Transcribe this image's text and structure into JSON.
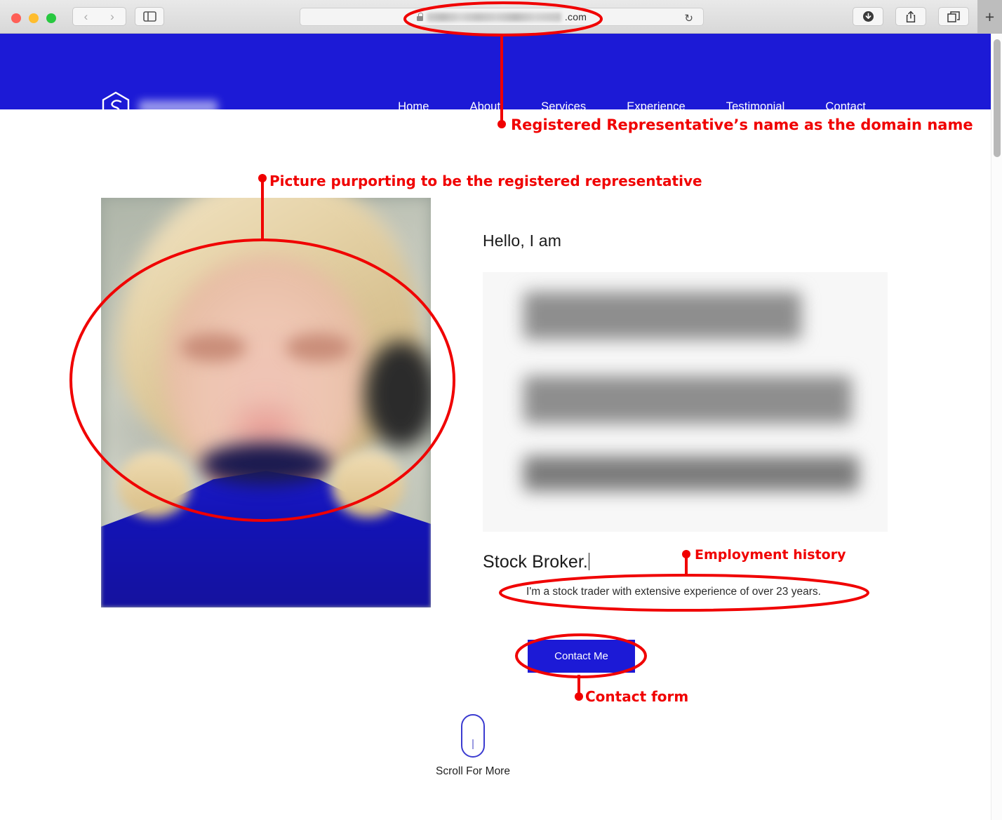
{
  "browser": {
    "window_controls": [
      "close",
      "minimize",
      "zoom"
    ],
    "back_icon": "‹",
    "forward_icon": "›",
    "sidebar_icon": "sidebar-icon",
    "address": {
      "lock_icon": "lock-icon",
      "domain_redacted": true,
      "tld": ".com",
      "reload_icon": "↻"
    },
    "downloads_icon": "downloads-icon",
    "share_icon": "share-icon",
    "tabs_icon": "tab-overview-icon",
    "new_tab_label": "+"
  },
  "site": {
    "logo_icon": "hexagon-s-logo-icon",
    "brand_name_redacted": true,
    "nav": [
      {
        "label": "Home",
        "active": true
      },
      {
        "label": "About",
        "active": false
      },
      {
        "label": "Services",
        "active": false
      },
      {
        "label": "Experience",
        "active": false
      },
      {
        "label": "Testimonial",
        "active": false
      },
      {
        "label": "Contact",
        "active": false
      }
    ],
    "hero": {
      "photo_alt": "blurred portrait of a blonde person wearing a blue shirt",
      "greeting": "Hello, I am",
      "name_redacted": true,
      "role": "Stock Broker.",
      "tagline": "I'm a stock trader with extensive experience of over 23 years.",
      "cta_label": "Contact Me",
      "scroll_label": "Scroll For More",
      "scroll_icon": "mouse-scroll-icon"
    },
    "colors": {
      "brand_blue": "#1c1ad6",
      "annotation_red": "#f00000"
    }
  },
  "annotations": [
    {
      "id": "domain",
      "text": "Registered Representative’s name as the domain name"
    },
    {
      "id": "picture",
      "text": "Picture purporting to be the registered representative"
    },
    {
      "id": "employ",
      "text": "Employment history"
    },
    {
      "id": "form",
      "text": "Contact form"
    }
  ]
}
